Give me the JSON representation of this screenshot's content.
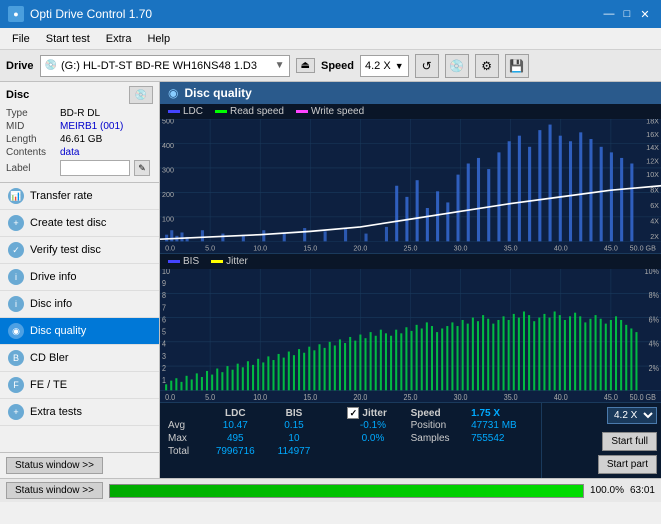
{
  "titleBar": {
    "title": "Opti Drive Control 1.70",
    "icon": "●",
    "minimizeBtn": "—",
    "maximizeBtn": "□",
    "closeBtn": "✕"
  },
  "menuBar": {
    "items": [
      "File",
      "Start test",
      "Extra",
      "Help"
    ]
  },
  "driveBar": {
    "driveLabel": "Drive",
    "driveValue": "(G:)  HL-DT-ST BD-RE  WH16NS48 1.D3",
    "ejectSymbol": "⏏",
    "speedLabel": "Speed",
    "speedValue": "4.2 X"
  },
  "discSection": {
    "title": "Disc",
    "rows": [
      {
        "label": "Type",
        "value": "BD-R DL"
      },
      {
        "label": "MID",
        "value": "MEIRB1 (001)"
      },
      {
        "label": "Length",
        "value": "46.61 GB"
      },
      {
        "label": "Contents",
        "value": "data"
      },
      {
        "label": "Label",
        "value": ""
      }
    ]
  },
  "navItems": [
    {
      "label": "Transfer rate",
      "active": false
    },
    {
      "label": "Create test disc",
      "active": false
    },
    {
      "label": "Verify test disc",
      "active": false
    },
    {
      "label": "Drive info",
      "active": false
    },
    {
      "label": "Disc info",
      "active": false
    },
    {
      "label": "Disc quality",
      "active": true
    },
    {
      "label": "CD Bler",
      "active": false
    },
    {
      "label": "FE / TE",
      "active": false
    },
    {
      "label": "Extra tests",
      "active": false
    }
  ],
  "statusBtn": "Status window >>",
  "chartTitle": "Disc quality",
  "chart1Legend": {
    "ldc": "LDC",
    "read": "Read speed",
    "write": "Write speed"
  },
  "chart2Legend": {
    "bis": "BIS",
    "jitter": "Jitter"
  },
  "stats": {
    "columns": [
      "LDC",
      "BIS",
      "",
      "Jitter",
      "Speed",
      ""
    ],
    "rows": [
      {
        "label": "Avg",
        "ldc": "10.47",
        "bis": "0.15",
        "jitter": "-0.1%",
        "speed_label": "Position",
        "speed_val": "47731 MB"
      },
      {
        "label": "Max",
        "ldc": "495",
        "bis": "10",
        "jitter": "0.0%",
        "speed_label": "Samples",
        "speed_val": "755542"
      },
      {
        "label": "Total",
        "ldc": "7996716",
        "bis": "114977",
        "jitter": ""
      }
    ],
    "jitterLabel": "Jitter",
    "speedLabel": "Speed",
    "speedValue": "1.75 X",
    "speedDropdown": "4.2 X"
  },
  "buttons": {
    "startFull": "Start full",
    "startPart": "Start part"
  },
  "bottomBar": {
    "statusWindow": "Status window >>",
    "progressPercent": "100.0%",
    "timeValue": "63:01"
  }
}
